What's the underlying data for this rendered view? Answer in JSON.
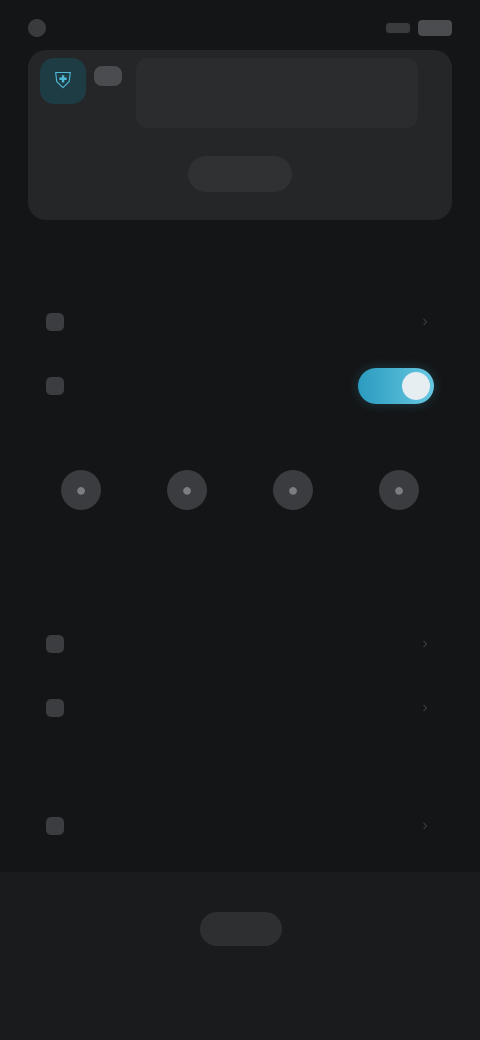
{
  "status_bar": {
    "time": "",
    "icons": [
      "app-icon",
      "signal-icon",
      "battery-icon"
    ]
  },
  "hero": {
    "title": "",
    "subtitle": "",
    "action_label": "",
    "icons": [
      "shield-icon",
      "avatar-icon"
    ]
  },
  "sections": {
    "s1_label": "",
    "s2_label": "",
    "s3_label": "",
    "s4_label": ""
  },
  "rows": {
    "r1": "",
    "r2": "",
    "r3": "",
    "r4": "",
    "r5": ""
  },
  "toggle": {
    "state": "on",
    "accent": "#5cc4e2"
  },
  "icon_grid": {
    "items": [
      {
        "label": "",
        "icon": "icon-1"
      },
      {
        "label": "",
        "icon": "icon-2"
      },
      {
        "label": "",
        "icon": "icon-3"
      },
      {
        "label": "",
        "icon": "icon-4"
      }
    ]
  },
  "bottom": {
    "button_label": "",
    "caption": ""
  },
  "colors": {
    "background": "#141516",
    "card": "#242628",
    "accent": "#5cc4e2"
  }
}
